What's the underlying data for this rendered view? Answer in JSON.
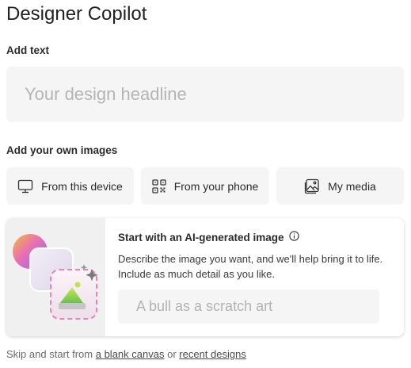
{
  "app": {
    "title": "Designer Copilot"
  },
  "add_text": {
    "label": "Add text",
    "placeholder": "Your design headline",
    "value": ""
  },
  "images": {
    "label": "Add your own images",
    "buttons": [
      {
        "label": "From this device",
        "icon": "monitor-icon"
      },
      {
        "label": "From your phone",
        "icon": "qr-code-icon"
      },
      {
        "label": "My media",
        "icon": "image-gallery-icon"
      }
    ]
  },
  "ai_card": {
    "title": "Start with an AI-generated image",
    "info_icon": "info-icon",
    "description": "Describe the image you want, and we'll help bring it to life. Include as much detail as you like.",
    "placeholder": "A bull as a scratch art",
    "value": ""
  },
  "footer": {
    "prefix": "Skip and start from",
    "blank_canvas": "a blank canvas",
    "connector": "or",
    "recent_designs": "recent designs"
  },
  "colors": {
    "field_background": "#f5f5f5",
    "text": "#2b2b2b",
    "placeholder": "#b5b5b5"
  }
}
